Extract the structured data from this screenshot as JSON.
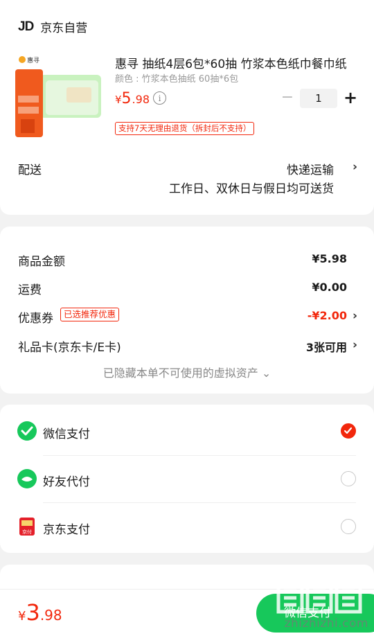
{
  "store": {
    "logo": "JD",
    "name": "京东自营"
  },
  "product": {
    "thumb_brand": "惠寻",
    "title": "惠寻 抽纸4层6包*60抽 竹浆本色纸巾餐巾纸",
    "spec": "颜色 : 竹浆本色抽纸 60抽*6包",
    "price_currency": "¥",
    "price_int": "5",
    "price_dec": ".98",
    "info_icon": "i",
    "quantity": "1",
    "minus": "−",
    "plus": "+",
    "return_tag": "支持7天无理由退货（拆封后不支持）"
  },
  "delivery": {
    "label": "配送",
    "method": "快递运输",
    "note": "工作日、双休日与假日均可送货",
    "chevron": "›"
  },
  "amounts": {
    "goods_label": "商品金额",
    "goods_value": "¥5.98",
    "shipping_label": "运费",
    "shipping_value": "¥0.00",
    "coupon_label": "优惠券",
    "coupon_tag": "已选推荐优惠",
    "coupon_value": "-¥2.00",
    "giftcard_label": "礼品卡(京东卡/E卡)",
    "giftcard_value": "3张可用",
    "chevron": "›",
    "hidden_note": "已隐藏本单不可使用的虚拟资产 ⌄"
  },
  "payment": {
    "options": [
      {
        "label": "微信支付",
        "selected": true,
        "icon": "wechat-pay-icon"
      },
      {
        "label": "好友代付",
        "selected": false,
        "icon": "friend-pay-icon"
      },
      {
        "label": "京东支付",
        "selected": false,
        "icon": "jd-pay-icon"
      }
    ],
    "jd_icon_text": "京付"
  },
  "footer": {
    "total_currency": "¥",
    "total_int": "3",
    "total_dec": ".98",
    "pay_button": "微信支付",
    "watermark": "zhizhizhi.com"
  },
  "colors": {
    "accent": "#f2270c",
    "wechat": "#17c85b"
  }
}
